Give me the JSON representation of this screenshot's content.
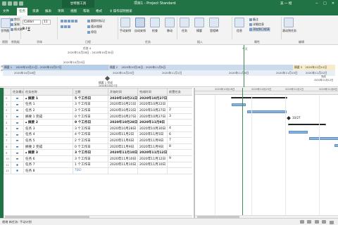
{
  "titlebar": {
    "context_tab": "甘特图工具",
    "document": "项目1  -  Project Standard",
    "user": "美 一 橙",
    "buttons": [
      "−",
      "□",
      "✕"
    ]
  },
  "tabs": [
    {
      "label": "文件",
      "active": false
    },
    {
      "label": "任务",
      "active": true
    },
    {
      "label": "资源",
      "active": false
    },
    {
      "label": "报表",
      "active": false
    },
    {
      "label": "项目",
      "active": false
    },
    {
      "label": "视图",
      "active": false
    },
    {
      "label": "帮助",
      "active": false
    },
    {
      "label": "格式",
      "active": false
    },
    {
      "label": "♀  操作说明搜索",
      "active": false
    }
  ],
  "ribbon": {
    "font": "Calibri",
    "size": "11",
    "groups": {
      "view": "视图",
      "clipboard": "剪贴板",
      "font": "字体",
      "schedule": "日程",
      "tasks": "任务",
      "insert": "插入",
      "properties": "属性",
      "editing": "编辑"
    },
    "buttons": {
      "gantt": "甘特图",
      "paste": "粘贴",
      "cut": "剪切",
      "copy": "复制",
      "format_painter": "格式刷",
      "mark_on_track": "跟踪时标记",
      "respect_links": "遵从链接",
      "inactivate": "停用",
      "manual": "手动安排",
      "auto": "自动安排",
      "inspect": "检查",
      "move": "移动",
      "mode": "模式",
      "task": "任务",
      "summary": "摘要",
      "milestone": "里程碑",
      "deliverable": "可交付结果",
      "information": "信息",
      "notes": "备注",
      "details": "详细信息",
      "add_to_timeline": "添加到日程表",
      "scroll_to_task": "滚动到任务"
    }
  },
  "timeline": {
    "callouts": [
      {
        "label": "任务 4",
        "sub": "2020年10月28日 - 2020年10月30日"
      },
      {
        "label": "2020年10月25日",
        "sub": ""
      },
      {
        "label": "今天",
        "sub": ""
      }
    ],
    "dates": [
      "2020年10月18日",
      "2020年10月25日",
      "2020年11月1日",
      "2020年11月8日",
      "2020年11月15日",
      "2020年11月22日"
    ],
    "bars": [
      {
        "label": "摘要 1",
        "dates": "2020年10月21日 - 2020年10月27日"
      },
      {
        "label": "摘要 2",
        "dates": "2020年10月28日 - 2020年11月9日"
      },
      {
        "label": "摘要 3",
        "dates": "2020年11月10日"
      }
    ],
    "milestone": {
      "label": "摘要 1 完成",
      "date": "2020年10月27日"
    },
    "scale": {
      "start": "开始",
      "start_date": "2020年10月21日",
      "end": "完成",
      "end_date": "2020年11月12日"
    }
  },
  "table": {
    "columns": [
      "任务模式",
      "任务名称",
      "工期",
      "开始时间",
      "完成时间",
      "前置任务"
    ],
    "rows": [
      {
        "id": "0",
        "mode": "▬",
        "name": "▴ 摘要 1",
        "duration": "5 个工作日",
        "start": "2020年10月21日",
        "finish": "2020年10月27日",
        "pred": "",
        "bold": true
      },
      {
        "id": "1",
        "mode": "▬",
        "name": "任务 1",
        "duration": "3 个工作日",
        "start": "2020年10月21日",
        "finish": "2020年10月22日",
        "pred": ""
      },
      {
        "id": "2",
        "mode": "▬",
        "name": "任务 2",
        "duration": "3 个工作日",
        "start": "2020年10月23日",
        "finish": "2020年10月27日",
        "pred": "2"
      },
      {
        "id": "3",
        "mode": "▬",
        "name": "摘要 1 完成",
        "duration": "0 个工作日",
        "start": "2020年10月27日",
        "finish": "2020年10月27日",
        "pred": "3"
      },
      {
        "id": "4",
        "mode": "▬",
        "name": "▴ 摘要 2",
        "duration": "9 个工作日",
        "start": "2020年10月28日",
        "finish": "2020年11月9日",
        "pred": "",
        "bold": true
      },
      {
        "id": "5",
        "mode": "▬",
        "name": "任务 3",
        "duration": "3 个工作日",
        "start": "2020年10月28日",
        "finish": "2020年10月30日",
        "pred": "4"
      },
      {
        "id": "6",
        "mode": "▬",
        "name": "任务 4",
        "duration": "4 个工作日",
        "start": "2020年11月2日",
        "finish": "2020年11月5日",
        "pred": "6"
      },
      {
        "id": "7",
        "mode": "▬",
        "name": "任务 5",
        "duration": "2 个工作日",
        "start": "2020年11月6日",
        "finish": "2020年11月9日",
        "pred": "7"
      },
      {
        "id": "8",
        "mode": "▬",
        "name": "摘要 2 完成",
        "duration": "0 个工作日",
        "start": "2020年11月9日",
        "finish": "2020年11月9日",
        "pred": "8"
      },
      {
        "id": "9",
        "mode": "▬",
        "name": "▴ 摘要 3",
        "duration": "3 个工作日",
        "start": "2020年11月10日",
        "finish": "2020年11月12日",
        "pred": "",
        "bold": true
      },
      {
        "id": "10",
        "mode": "▬",
        "name": "任务 6",
        "duration": "3 个工作日",
        "start": "2020年11月10日",
        "finish": "2020年11月12日",
        "pred": "9"
      },
      {
        "id": "11",
        "mode": "✱",
        "name": "任务 7",
        "duration": "1 个工作日",
        "start": "2020年11月10日",
        "finish": "2020年11月10日",
        "pred": ""
      },
      {
        "id": "12",
        "mode": "✱",
        "name": "任务 8",
        "duration": "TBD",
        "start": "",
        "finish": "",
        "pred": "",
        "tbd": true
      }
    ]
  },
  "gantt": {
    "dates": [
      "2020年10月18日",
      "2020年10月25日",
      "2020年11月1日",
      "2020年11月8日"
    ],
    "milestone_label": "10/27",
    "colors": {
      "task": "#8ab4e0",
      "summary": "#222222",
      "today": "#3c8f4f"
    }
  },
  "status": {
    "text": "就绪  新任务: 手动计划"
  },
  "colors": {
    "accent": "#217346"
  }
}
